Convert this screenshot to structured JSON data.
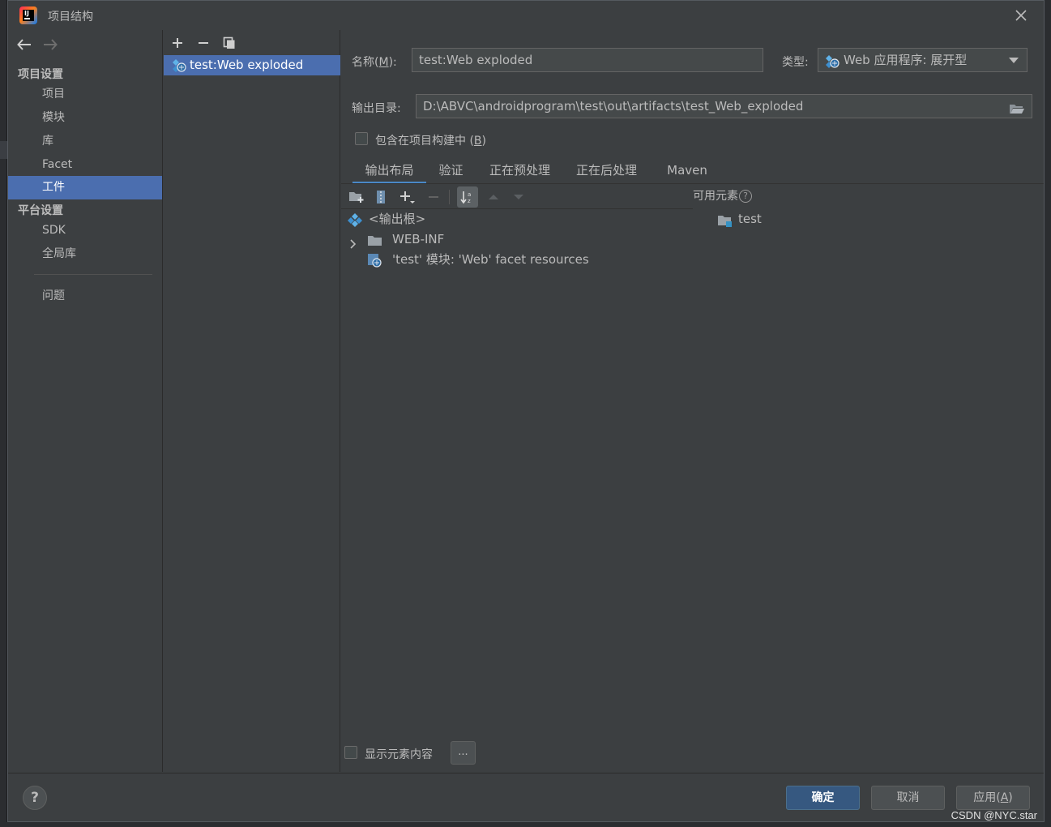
{
  "window": {
    "title": "项目结构"
  },
  "sidebar": {
    "section_project": "项目设置",
    "items": [
      {
        "label": "项目"
      },
      {
        "label": "模块"
      },
      {
        "label": "库"
      },
      {
        "label": "Facet"
      },
      {
        "label": "工件",
        "selected": true
      }
    ],
    "section_platform": "平台设置",
    "platform_items": [
      {
        "label": "SDK"
      },
      {
        "label": "全局库"
      }
    ],
    "problems": "问题"
  },
  "artifacts": {
    "items": [
      {
        "label": "test:Web exploded",
        "selected": true
      }
    ]
  },
  "form": {
    "name_label": "名称(",
    "name_mnemonic": "M",
    "name_label_end": "):",
    "name_value": "test:Web exploded",
    "type_label": "类型:",
    "type_value": "Web 应用程序: 展开型",
    "output_label": "输出目录:",
    "output_value": "D:\\ABVC\\androidprogram\\test\\out\\artifacts\\test_Web_exploded",
    "include_label": "包含在项目构建中 (",
    "include_mnemonic": "B",
    "include_label_end": ")",
    "include_checked": false
  },
  "tabs": [
    {
      "label": "输出布局",
      "active": true
    },
    {
      "label": "验证"
    },
    {
      "label": "正在预处理"
    },
    {
      "label": "正在后处理"
    },
    {
      "label": "Maven"
    }
  ],
  "layout_tree": [
    {
      "label": "<输出根>",
      "icon": "output-root-icon"
    },
    {
      "label": "WEB-INF",
      "icon": "folder-icon",
      "expandable": true
    },
    {
      "label": "'test' 模块: 'Web' facet resources",
      "icon": "web-facet-icon"
    }
  ],
  "available": {
    "title": "可用元素",
    "items": [
      {
        "label": "test",
        "icon": "module-folder-icon"
      }
    ]
  },
  "show_content": {
    "label": "显示元素内容",
    "checked": false,
    "more_button": "..."
  },
  "buttons": {
    "ok": "确定",
    "cancel": "取消",
    "apply_prefix": "应用(",
    "apply_mnemonic": "A",
    "apply_suffix": ")"
  },
  "watermark": "CSDN @NYC.star",
  "colors": {
    "selection": "#4b6eaf",
    "background": "#3c3f41",
    "primary_button": "#365880"
  }
}
